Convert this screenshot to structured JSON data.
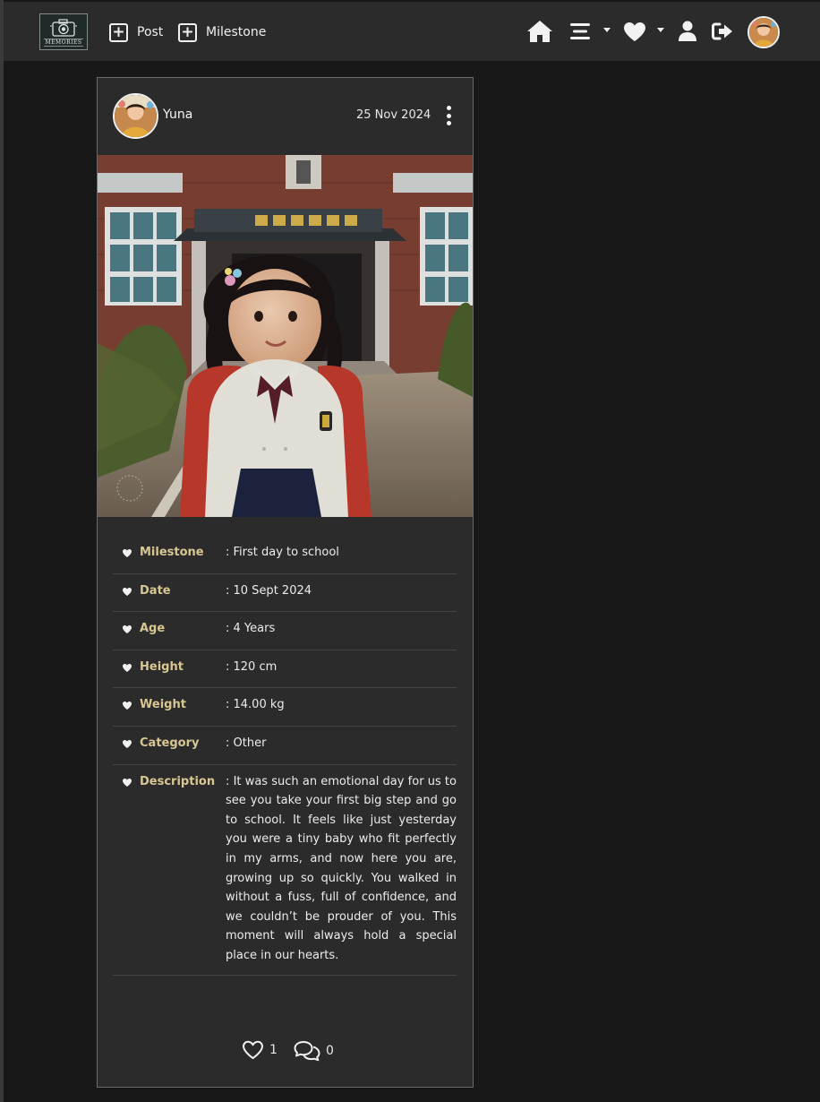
{
  "logo": {
    "text": "MEMORIES"
  },
  "nav": {
    "post_label": "Post",
    "milestone_label": "Milestone",
    "icons": [
      "home-icon",
      "menu-icon",
      "heart-icon",
      "user-icon",
      "logout-icon"
    ]
  },
  "post": {
    "author": "Yuna",
    "date": "25 Nov 2024",
    "details": [
      {
        "label": "Milestone",
        "value": ": First day to school"
      },
      {
        "label": "Date",
        "value": ": 10 Sept 2024"
      },
      {
        "label": "Age",
        "value": ": 4 Years"
      },
      {
        "label": "Height",
        "value": ": 120 cm"
      },
      {
        "label": "Weight",
        "value": ": 14.00 kg"
      },
      {
        "label": "Category",
        "value": ": Other"
      },
      {
        "label": "Description",
        "value": ": It was such an emotional day for us to see you take your first big step and go to school. It feels like just yesterday you were a tiny baby who fit perfectly in my arms, and now here you are, growing up so quickly. You walked in without a fuss, full of confidence, and we couldn’t be prouder of you. This moment will always hold a special place in our hearts."
      }
    ],
    "likes": "1",
    "comments": "0"
  },
  "colors": {
    "background": "#181818",
    "surface": "#2b2b2b",
    "label": "#d8c791",
    "text": "#ececec"
  }
}
